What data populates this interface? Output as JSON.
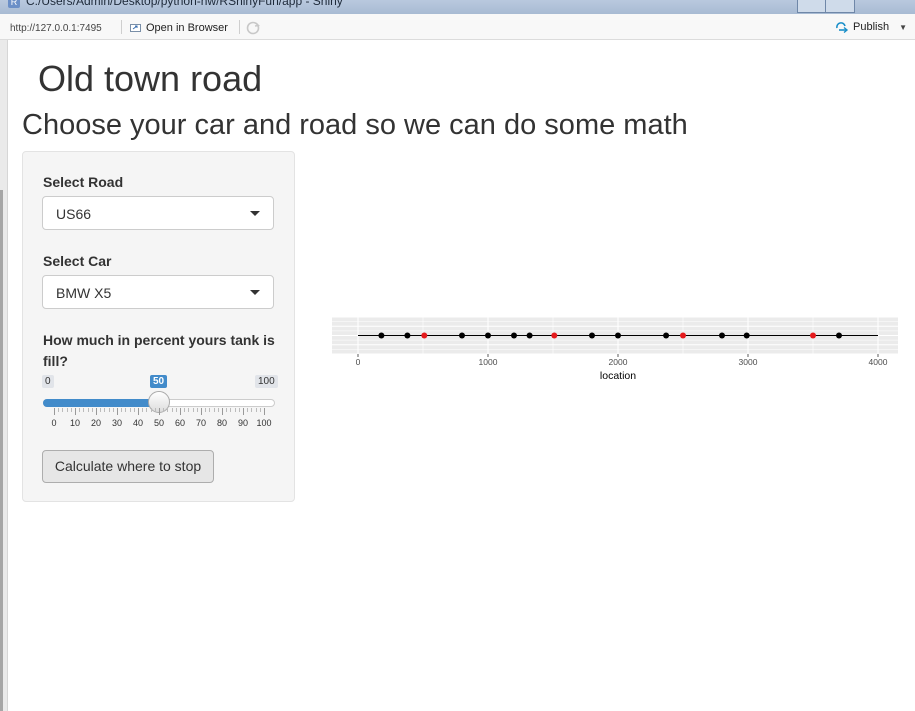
{
  "window": {
    "title": "C:/Users/Admin/Desktop/python-hw/RShinyFun/app - Shiny"
  },
  "toolbar": {
    "url": "http://127.0.0.1:7495",
    "open_in_browser_label": "Open in Browser",
    "publish_label": "Publish"
  },
  "page": {
    "title": "Old town road",
    "subtitle": "Choose your car and road so we can do some math"
  },
  "sidebar": {
    "road_label": "Select Road",
    "road_value": "US66",
    "car_label": "Select Car",
    "car_value": "BMW X5",
    "tank_label": "How much in percent yours tank is fill?",
    "slider": {
      "min": 0,
      "max": 100,
      "value": 50,
      "min_label": "0",
      "max_label": "100",
      "value_label": "50",
      "grid_labels": [
        "0",
        "10",
        "20",
        "30",
        "40",
        "50",
        "60",
        "70",
        "80",
        "90",
        "100"
      ]
    },
    "calculate_label": "Calculate where to stop"
  },
  "chart_data": {
    "type": "scatter",
    "xlabel": "location",
    "ylabel": "",
    "xlim": [
      0,
      4000
    ],
    "x_ticks": [
      0,
      1000,
      2000,
      3000,
      4000
    ],
    "x_tick_labels": [
      "0",
      "1000",
      "2000",
      "3000",
      "4000"
    ],
    "line": [
      0,
      4000
    ],
    "series": [
      {
        "color": "#000000",
        "x": [
          180,
          380,
          800,
          1000,
          1200,
          1320,
          1800,
          2000,
          2370,
          2800,
          2990,
          3700
        ]
      },
      {
        "color": "#e41a1c",
        "x": [
          510,
          1510,
          2500,
          3500
        ]
      }
    ]
  }
}
